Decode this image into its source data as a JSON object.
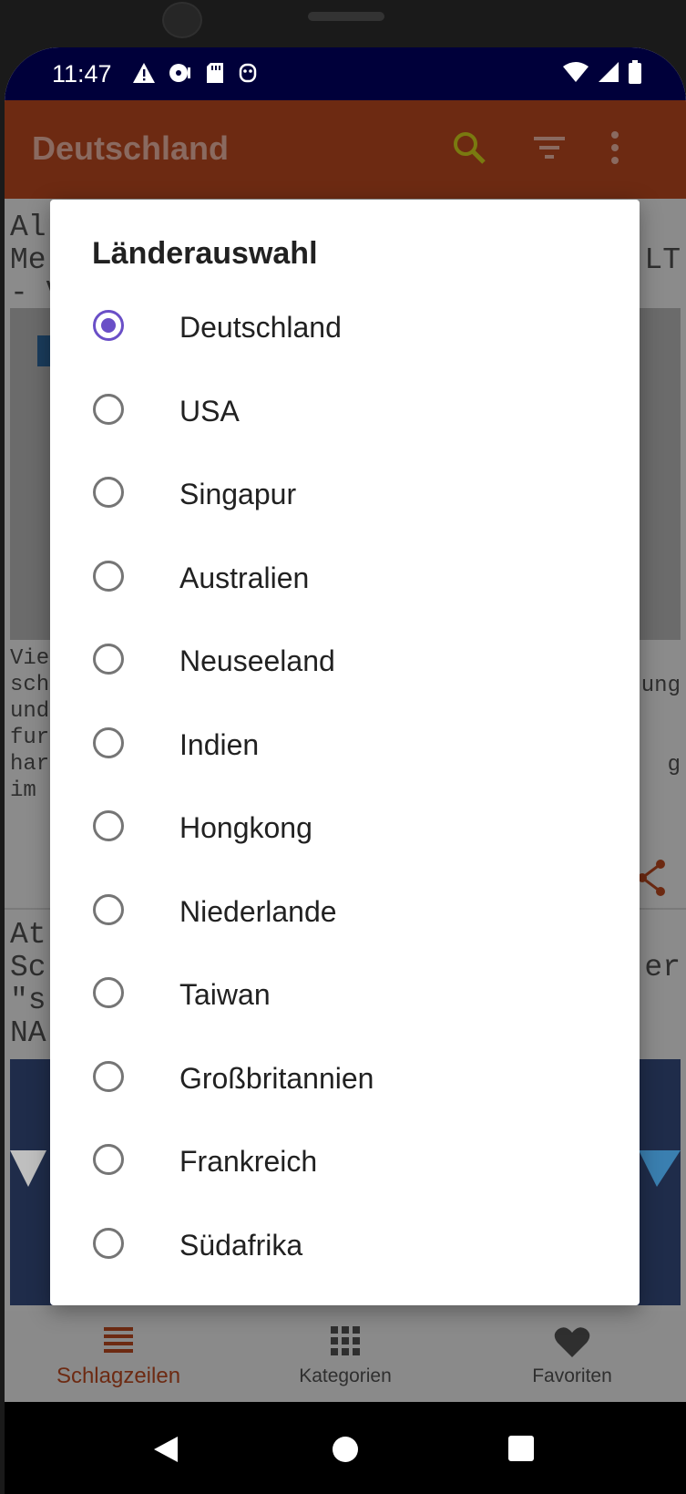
{
  "status_bar": {
    "time": "11:47",
    "left_icons": [
      "warning-icon",
      "media-icon",
      "sd-card-icon",
      "accessibility-icon"
    ],
    "right_icons": [
      "wifi-icon",
      "signal-icon",
      "battery-icon"
    ]
  },
  "app_bar": {
    "title": "Deutschland",
    "icons": [
      "search-icon",
      "filter-icon",
      "more-vert-icon"
    ]
  },
  "background_content": {
    "article1": {
      "title_left": "Al\nMe\n- V",
      "title_right": "LT",
      "text_left": "Vie\nsch\nund\nfur\nhar\nim",
      "text_right": "ung\n\n\ng"
    },
    "article2": {
      "title_left": "At\nSc\n\"s\nNA",
      "title_right": "er"
    }
  },
  "dialog": {
    "title": "Länderauswahl",
    "selected": "Deutschland",
    "options": [
      {
        "label": "Deutschland",
        "checked": true
      },
      {
        "label": "USA",
        "checked": false
      },
      {
        "label": "Singapur",
        "checked": false
      },
      {
        "label": "Australien",
        "checked": false
      },
      {
        "label": "Neuseeland",
        "checked": false
      },
      {
        "label": "Indien",
        "checked": false
      },
      {
        "label": "Hongkong",
        "checked": false
      },
      {
        "label": "Niederlande",
        "checked": false
      },
      {
        "label": "Taiwan",
        "checked": false
      },
      {
        "label": "Großbritannien",
        "checked": false
      },
      {
        "label": "Frankreich",
        "checked": false
      },
      {
        "label": "Südafrika",
        "checked": false
      }
    ]
  },
  "bottom_nav": {
    "items": [
      {
        "label": "Schlagzeilen",
        "icon": "list-icon",
        "active": true
      },
      {
        "label": "Kategorien",
        "icon": "grid-icon",
        "active": false
      },
      {
        "label": "Favoriten",
        "icon": "heart-icon",
        "active": false
      }
    ]
  },
  "colors": {
    "accent": "#6a4fc7",
    "app_bar": "#6d2a12",
    "status_bar": "#00003a"
  }
}
